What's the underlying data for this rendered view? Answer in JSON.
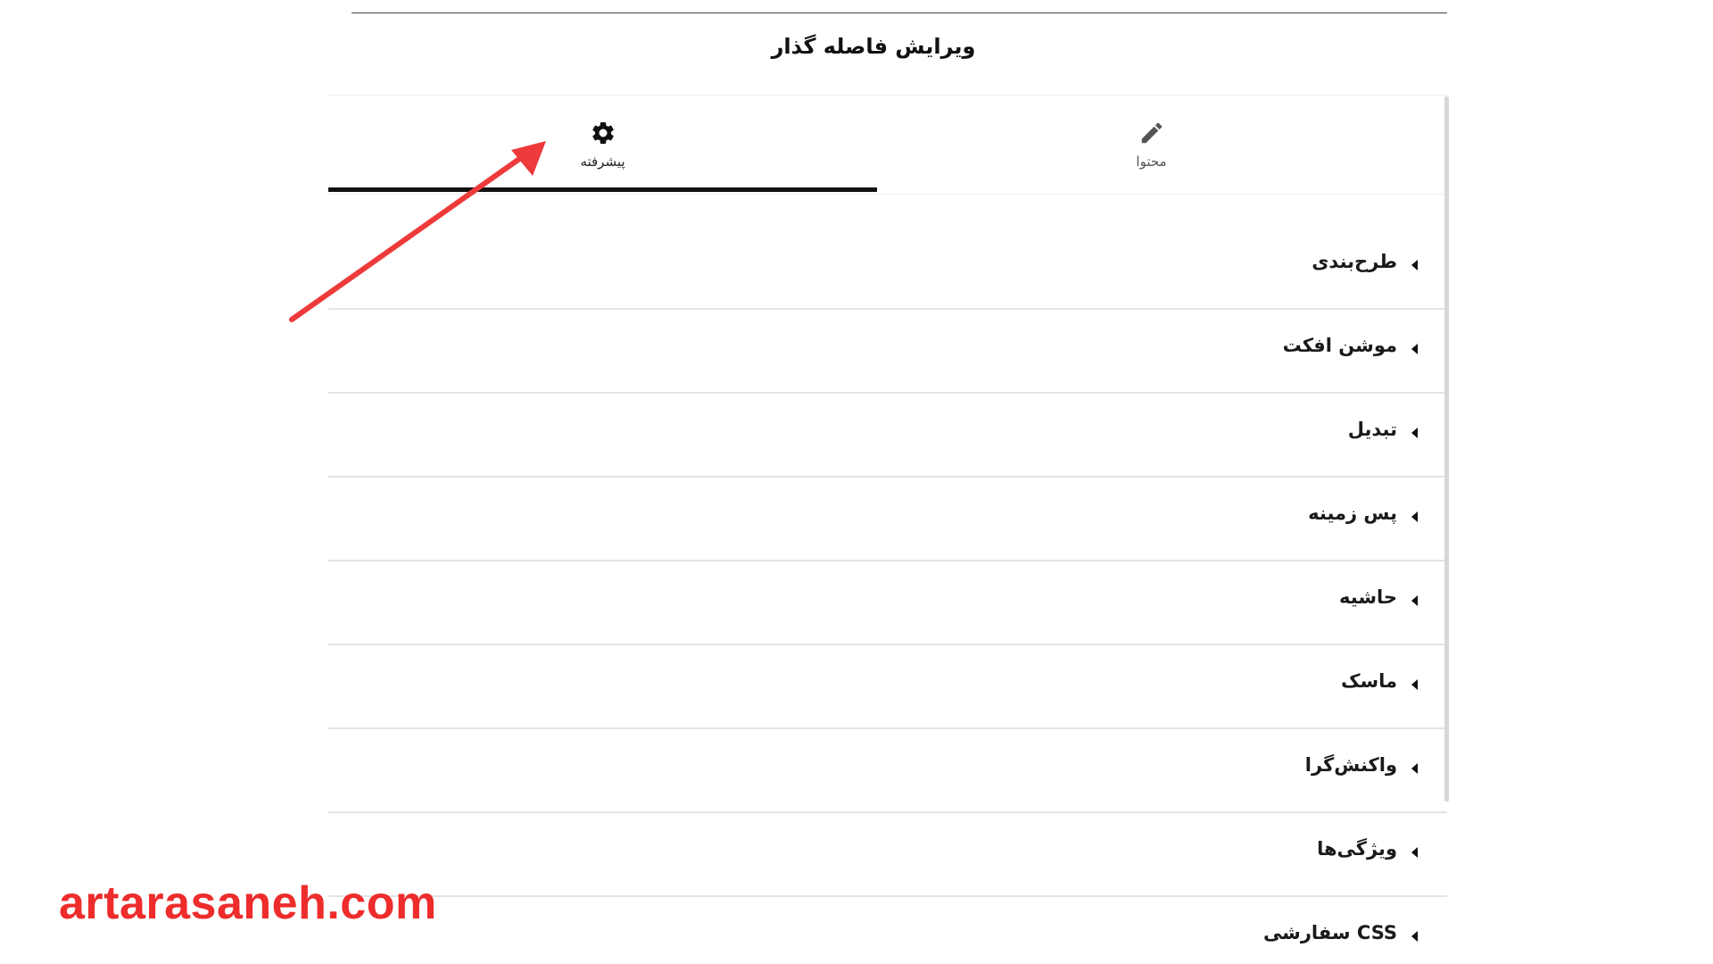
{
  "header": {
    "title": "ویرایش فاصله گذار"
  },
  "tabs": [
    {
      "id": "advanced",
      "label": "پیشرفته",
      "icon": "gear-icon",
      "active": true
    },
    {
      "id": "content",
      "label": "محتوا",
      "icon": "pencil-icon",
      "active": false
    }
  ],
  "sections": [
    {
      "label": "طرح‌بندی",
      "icon": "caret-left-icon"
    },
    {
      "label": "موشن افکت",
      "icon": "caret-left-icon"
    },
    {
      "label": "تبدیل",
      "icon": "caret-left-icon"
    },
    {
      "label": "پس زمینه",
      "icon": "caret-left-icon"
    },
    {
      "label": "حاشیه",
      "icon": "caret-left-icon"
    },
    {
      "label": "ماسک",
      "icon": "caret-left-icon"
    },
    {
      "label": "واکنش‌گرا",
      "icon": "caret-left-icon"
    },
    {
      "label": "ویژگی‌ها",
      "icon": "caret-left-icon"
    },
    {
      "label": "CSS سفارشی",
      "icon": "caret-left-icon"
    }
  ],
  "annotation": {
    "arrow_icon": "red-arrow-icon",
    "arrow_color": "#ee3a3a"
  },
  "watermark": {
    "text": "artarasaneh.com",
    "color": "#ee2c2c"
  },
  "colors": {
    "active_tab_underline": "#111111",
    "divider": "#e3e3e3"
  }
}
